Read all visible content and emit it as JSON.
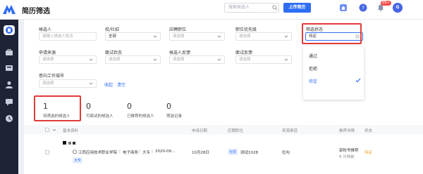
{
  "header": {
    "title": "简历筛选",
    "search_placeholder": "搜索候选人",
    "upload_label": "上传简历",
    "notification_badge": "99+",
    "avatar_initial": "G"
  },
  "filters": {
    "candidate": {
      "label": "候选人",
      "placeholder": "请输入候选人姓名"
    },
    "campus": {
      "label": "校/社招",
      "value": "全部"
    },
    "job": {
      "label": "应聘职位",
      "placeholder": "请选择"
    },
    "priority": {
      "label": "职位优先级",
      "placeholder": "请选择"
    },
    "screen_status": {
      "label": "筛选状态",
      "value": "待定"
    },
    "source": {
      "label": "申请来源",
      "placeholder": "请选择"
    },
    "interview_status": {
      "label": "面试状态",
      "placeholder": "请选择"
    },
    "feedback": {
      "label": "候选人反馈",
      "placeholder": "请选择"
    },
    "interview_feedback": {
      "label": "面试反馈",
      "placeholder": "请选择"
    },
    "city": {
      "label": "意向工作城市",
      "placeholder": "请选择"
    },
    "collapse": "收起",
    "clear": "清空"
  },
  "dropdown": {
    "options": [
      "通过",
      "拒绝",
      "待定"
    ],
    "selected": "待定"
  },
  "stats": [
    {
      "num": "1",
      "label": "待筛选的候选人"
    },
    {
      "num": "0",
      "label": "可面试的候选人"
    },
    {
      "num": "0",
      "label": "已推荐的候选人"
    },
    {
      "num": "0",
      "label": "筛选记录"
    }
  ],
  "table": {
    "headers": {
      "basic": "基本资料",
      "date": "申请日期",
      "job": "应聘职位",
      "source": "来源渠道",
      "recommend": "推荐详情",
      "status": "状态"
    },
    "rows": [
      {
        "school": "江西应用技术职业学院",
        "major": "电子商务",
        "degree": "大专",
        "grad": "2020-09...",
        "edu_tag": "大专",
        "date": "10月28日",
        "job_tag": "社招",
        "job": "测试1028",
        "source": "拉勾",
        "recommender": "郭秋爷推荐",
        "ago": "6 分钟前",
        "status": "待定"
      }
    ]
  },
  "colors": {
    "accent": "#2f6df6",
    "highlight_box": "#e23b3b",
    "sidebar": "#1e2436",
    "status_pending": "#f0a020"
  }
}
